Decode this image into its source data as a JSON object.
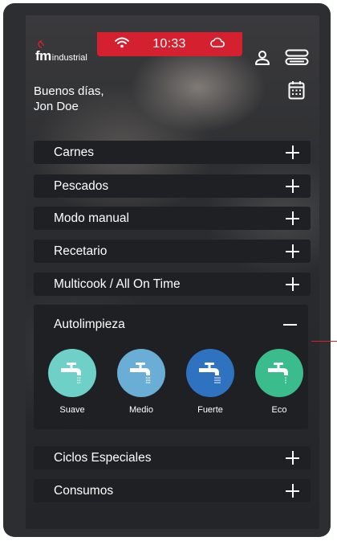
{
  "status": {
    "time": "10:33",
    "wifi_icon": "wifi-icon",
    "cloud_icon": "cloud-icon",
    "bar_color": "#d4202f"
  },
  "brand": {
    "mark": "fm",
    "text": "industrial"
  },
  "greeting": {
    "line1": "Buenos días,",
    "line2": "Jon Doe"
  },
  "header_icons": [
    "user-icon",
    "storage-icon",
    "calendar-icon"
  ],
  "menu": [
    {
      "label": "Carnes"
    },
    {
      "label": "Pescados"
    },
    {
      "label": "Modo manual"
    },
    {
      "label": "Recetario"
    },
    {
      "label": "Multicook / All On Time"
    }
  ],
  "expanded": {
    "label": "Autolimpieza",
    "programs": [
      {
        "label": "Suave",
        "color": "#6fd0c8",
        "icon": "faucet-icon"
      },
      {
        "label": "Medio",
        "color": "#6aaed6",
        "icon": "faucet-icon"
      },
      {
        "label": "Fuerte",
        "color": "#2f72c0",
        "icon": "faucet-icon"
      },
      {
        "label": "Eco",
        "color": "#3bbc8c",
        "icon": "faucet-icon"
      }
    ]
  },
  "menu_bottom": [
    {
      "label": "Ciclos Especiales"
    },
    {
      "label": "Consumos"
    }
  ]
}
